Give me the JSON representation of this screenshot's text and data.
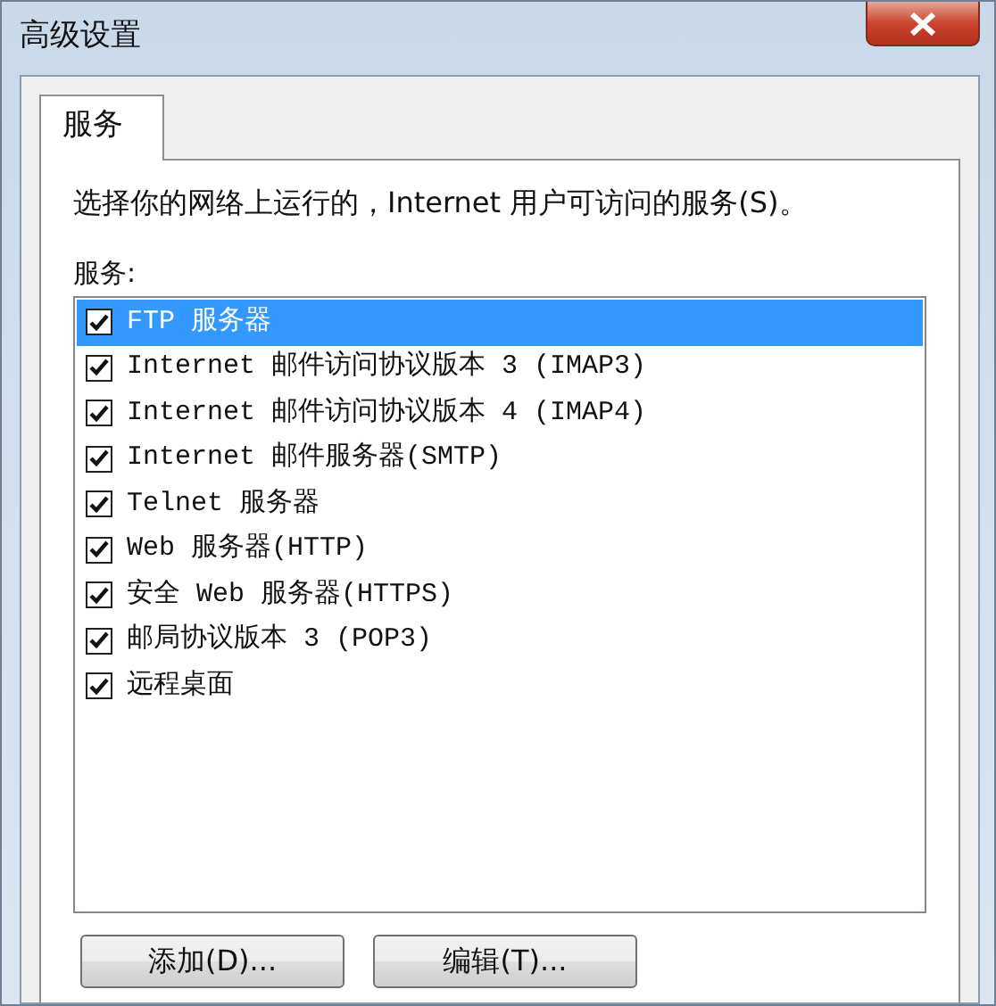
{
  "window": {
    "title": "高级设置"
  },
  "tabs": [
    {
      "label": "服务",
      "selected": true
    }
  ],
  "description": "选择你的网络上运行的，Internet 用户可访问的服务(S)。",
  "services_label": "服务:",
  "services": [
    {
      "label": "FTP 服务器",
      "checked": true,
      "selected": true
    },
    {
      "label": "Internet 邮件访问协议版本 3 (IMAP3)",
      "checked": true,
      "selected": false
    },
    {
      "label": "Internet 邮件访问协议版本 4 (IMAP4)",
      "checked": true,
      "selected": false
    },
    {
      "label": "Internet 邮件服务器(SMTP)",
      "checked": true,
      "selected": false
    },
    {
      "label": "Telnet 服务器",
      "checked": true,
      "selected": false
    },
    {
      "label": "Web 服务器(HTTP)",
      "checked": true,
      "selected": false
    },
    {
      "label": "安全 Web 服务器(HTTPS)",
      "checked": true,
      "selected": false
    },
    {
      "label": "邮局协议版本 3 (POP3)",
      "checked": true,
      "selected": false
    },
    {
      "label": "远程桌面",
      "checked": true,
      "selected": false
    }
  ],
  "buttons": [
    "添加(D)...",
    "编辑(T)..."
  ]
}
